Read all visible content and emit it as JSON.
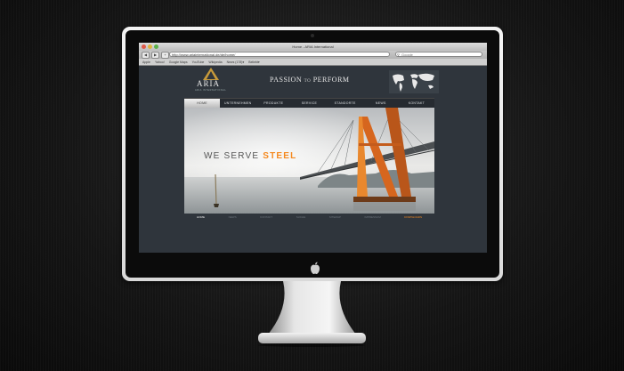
{
  "browser": {
    "window_title": "Home - ARIA International",
    "url": "http://www.ariainternational.de/de/home/",
    "search_placeholder": "Google",
    "bookmarks": [
      "Apple",
      "Yahoo!",
      "Google Maps",
      "YouTube",
      "Wikipedia",
      "News (178)▾",
      "Beliebt▾"
    ]
  },
  "site": {
    "logo": "ARIA",
    "logo_sub": "ARIA INTERNATIONAL",
    "tagline_a": "PASSION",
    "tagline_to": "TO",
    "tagline_b": "PERFORM",
    "nav": [
      "HOME",
      "UNTERNEHMEN",
      "PRODUKTE",
      "SERVICE",
      "STANDORTE",
      "NEWS",
      "KONTAKT"
    ],
    "hero_word1": "WE SERVE",
    "hero_word2": "STEEL",
    "subnav": [
      "HOME",
      "NEWS",
      "KONTAKT",
      "SUCHE",
      "SITEMAP",
      "IMPRESSUM",
      "DOWNLOADS"
    ]
  },
  "colors": {
    "accent": "#f5891f",
    "page_bg": "#2f353c"
  }
}
